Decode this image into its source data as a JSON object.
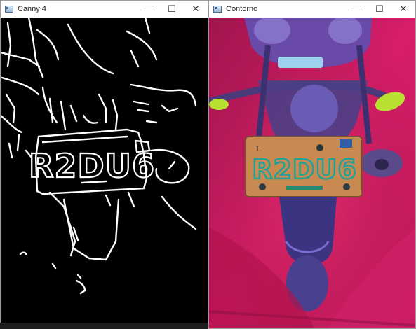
{
  "canny_window": {
    "title": "Canny 4",
    "plate_text": "R2DU6",
    "controls": {
      "minimize": "—",
      "maximize": "☐",
      "close": "✕"
    },
    "icon": "opencv-window-icon"
  },
  "contour_window": {
    "title": "Contorno",
    "plate_text": "R2DU6",
    "plate_marker": "T",
    "controls": {
      "minimize": "—",
      "maximize": "☐",
      "close": "✕"
    },
    "icon": "opencv-window-icon"
  },
  "colors": {
    "canny_bg": "#000000",
    "edge": "#ffffff",
    "contour_bg": "#c21a62",
    "plate_fill": "#c98a52",
    "plate_text": "#1aa39a",
    "turn_signal": "#b8e030"
  }
}
